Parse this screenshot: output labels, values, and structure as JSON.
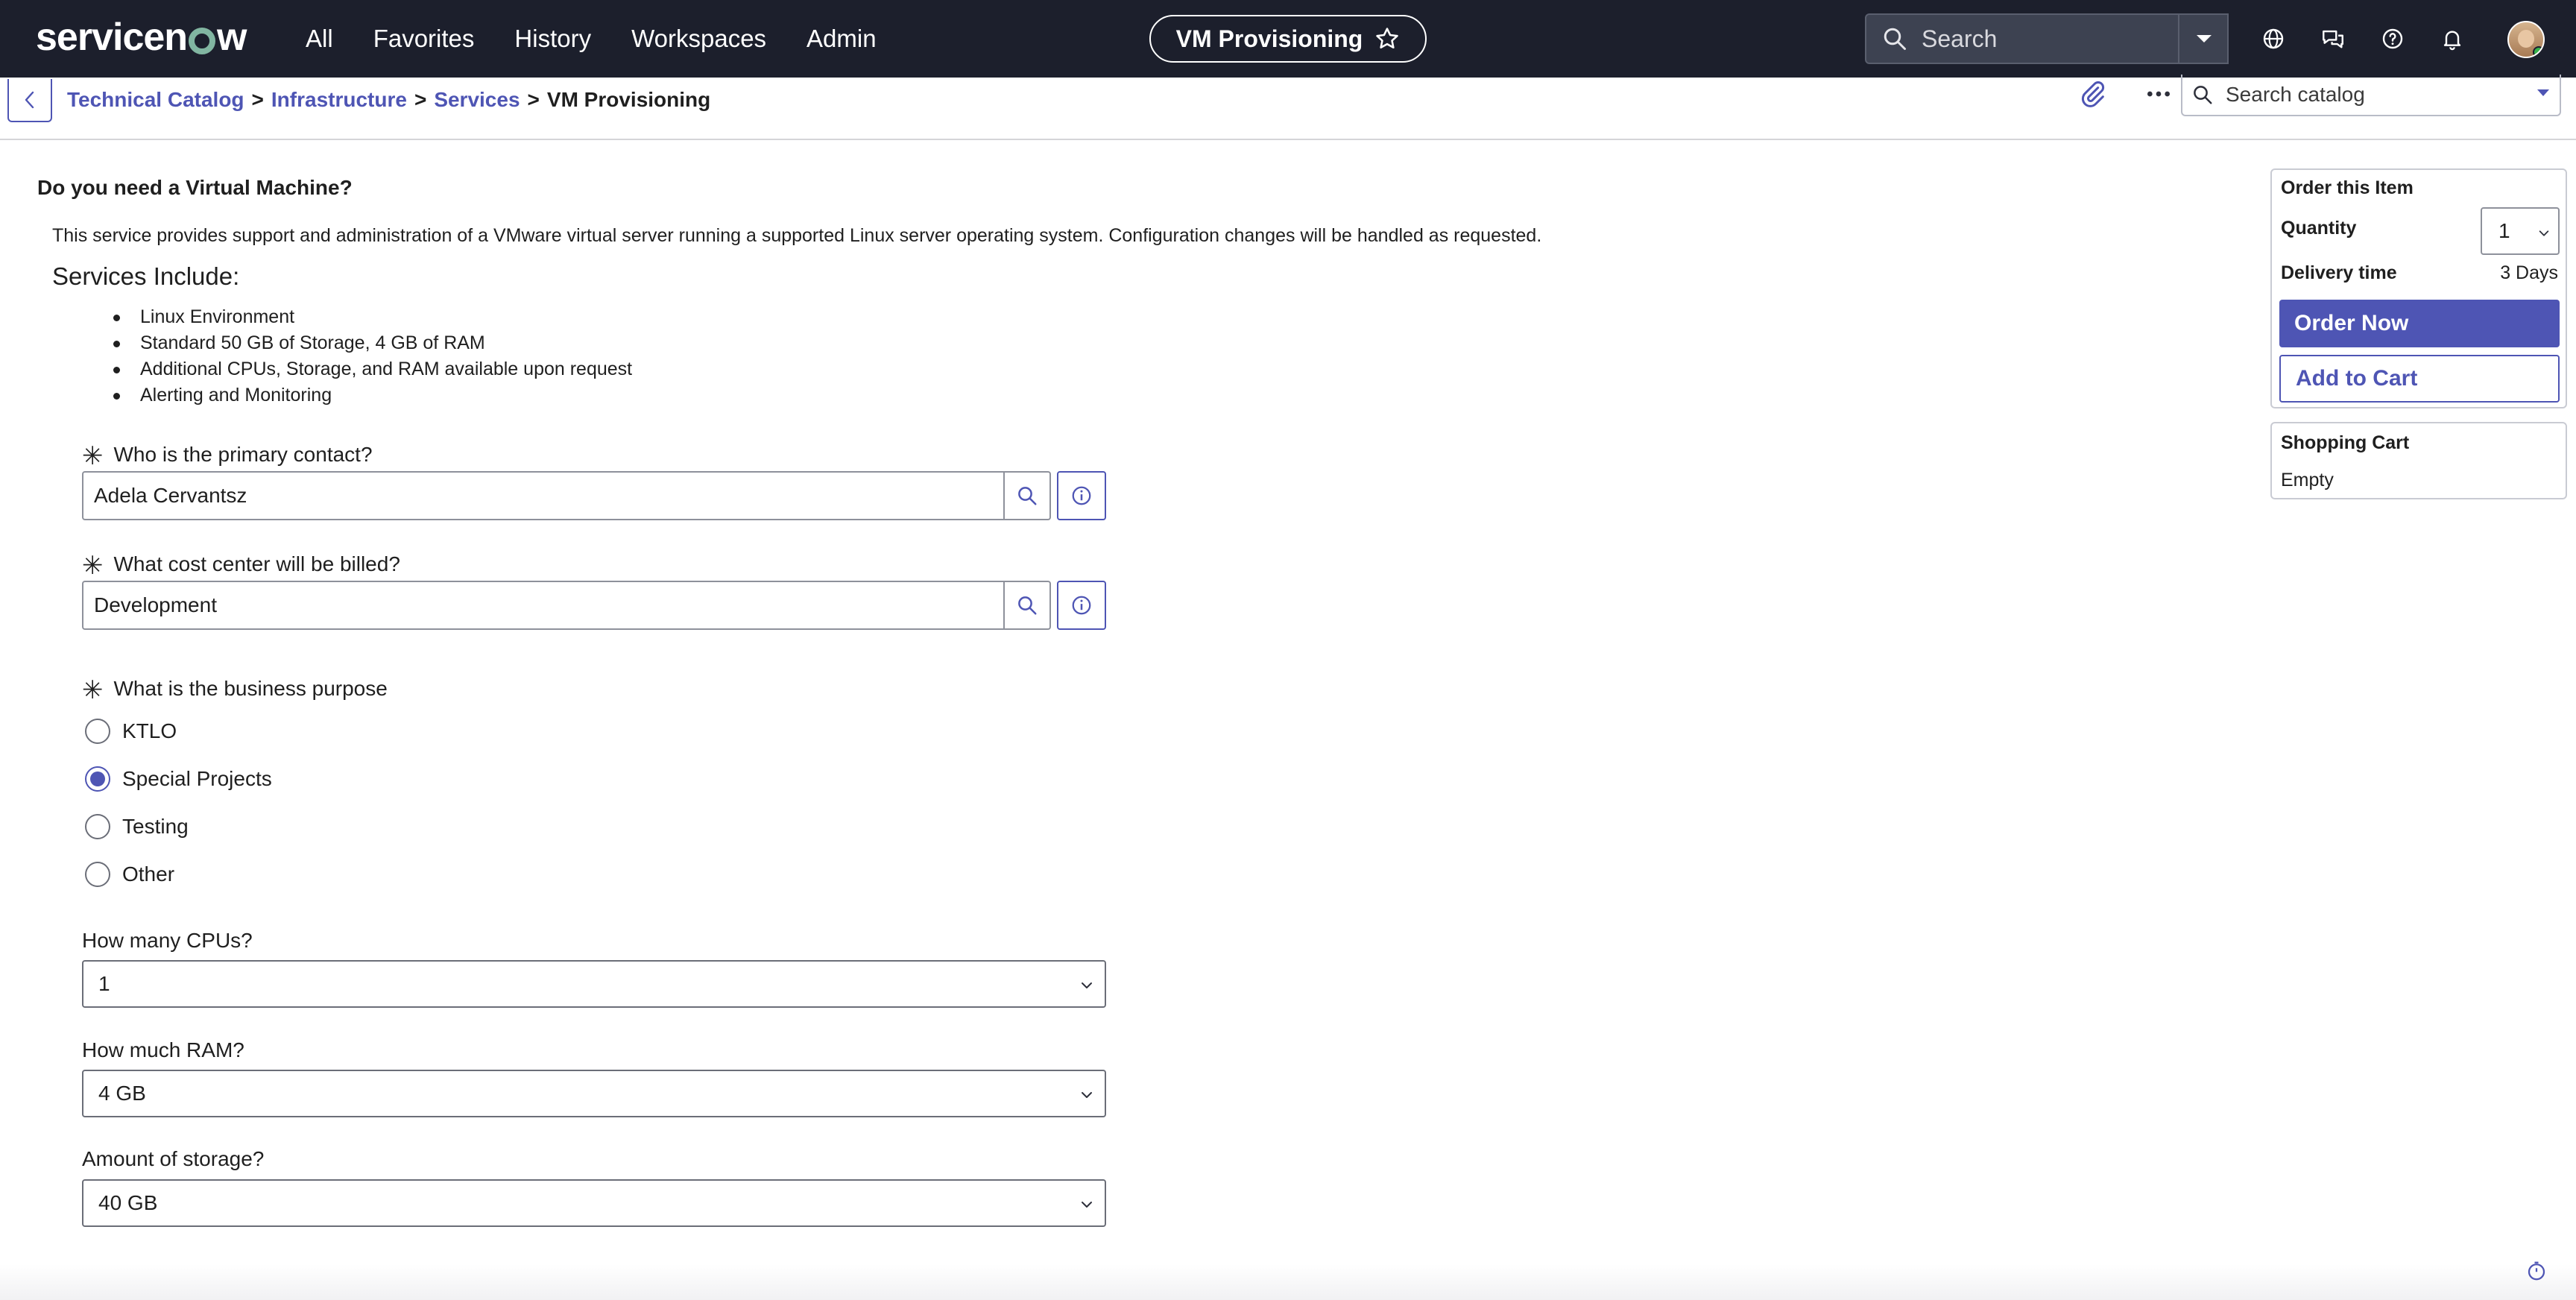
{
  "topbar": {
    "logo": "servicenow",
    "nav": [
      "All",
      "Favorites",
      "History",
      "Workspaces",
      "Admin"
    ],
    "page_title": "VM Provisioning",
    "search_placeholder": "Search",
    "icons": [
      "globe-icon",
      "chat-icon",
      "help-icon",
      "bell-icon"
    ]
  },
  "breadcrumb": {
    "items": [
      "Technical Catalog",
      "Infrastructure",
      "Services"
    ],
    "separator": ">",
    "current": "VM Provisioning"
  },
  "catalog_search": {
    "placeholder": "Search catalog"
  },
  "item": {
    "title": "Do you need a Virtual Machine?",
    "description": "This service provides support and administration of a VMware virtual server running a supported Linux server operating system. Configuration changes will be handled as requested.",
    "services_heading": "Services Include:",
    "services": [
      "Linux Environment",
      "Standard 50 GB of Storage, 4 GB of RAM",
      "Additional CPUs, Storage, and RAM available upon request",
      "Alerting and Monitoring"
    ]
  },
  "form": {
    "required_marker": "✳",
    "contact": {
      "label": "Who is the primary contact?",
      "value": "Adela Cervantsz"
    },
    "cost_center": {
      "label": "What cost center will be billed?",
      "value": "Development"
    },
    "purpose": {
      "label": "What is the business purpose",
      "options": [
        "KTLO",
        "Special Projects",
        "Testing",
        "Other"
      ],
      "selected": "Special Projects"
    },
    "cpus": {
      "label": "How many CPUs?",
      "value": "1"
    },
    "ram": {
      "label": "How much RAM?",
      "value": "4 GB"
    },
    "storage": {
      "label": "Amount of storage?",
      "value": "40 GB"
    }
  },
  "order": {
    "title": "Order this Item",
    "quantity_label": "Quantity",
    "quantity": "1",
    "delivery_label": "Delivery time",
    "delivery_value": "3 Days",
    "order_now": "Order Now",
    "add_to_cart": "Add to Cart"
  },
  "cart": {
    "title": "Shopping Cart",
    "status": "Empty"
  },
  "colors": {
    "topbar": "#1c1f2c",
    "accent": "#4e55b4",
    "logo_o": "#81b5a1"
  }
}
